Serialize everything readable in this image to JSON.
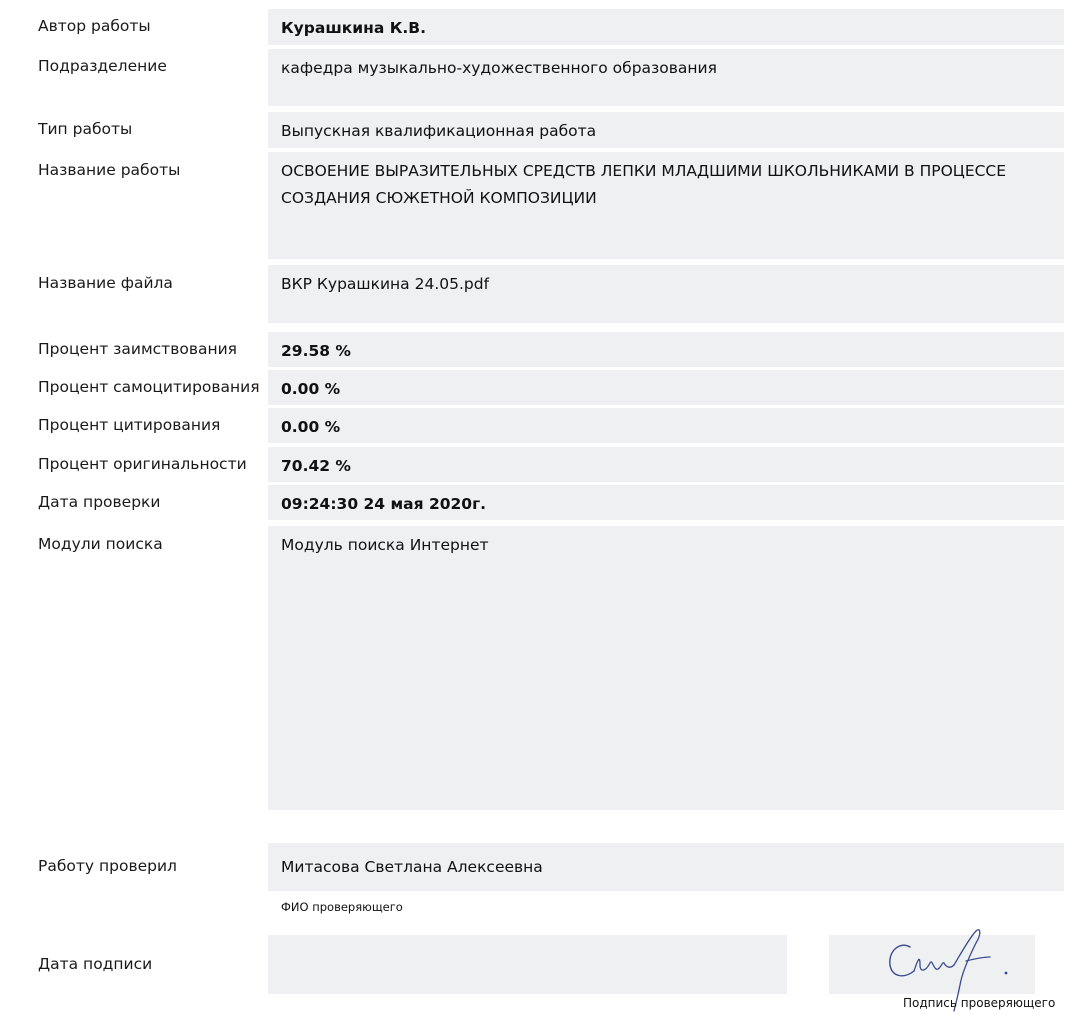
{
  "fields": {
    "author": {
      "label": "Автор работы",
      "value": "Курашкина К.В."
    },
    "department": {
      "label": "Подразделение",
      "value": "кафедра музыкально-художественного образования"
    },
    "work_type": {
      "label": "Тип работы",
      "value": "Выпускная квалификационная работа"
    },
    "work_title": {
      "label": "Название работы",
      "value": "ОСВОЕНИЕ ВЫРАЗИТЕЛЬНЫХ СРЕДСТВ ЛЕПКИ МЛАДШИМИ ШКОЛЬНИКАМИ В ПРОЦЕССЕ СОЗДАНИЯ СЮЖЕТНОЙ КОМПОЗИЦИИ"
    },
    "file_name": {
      "label": "Название файла",
      "value": "ВКР Курашкина 24.05.pdf"
    },
    "borrowing": {
      "label": "Процент заимствования",
      "value": "29.58 %"
    },
    "self_citation": {
      "label": "Процент самоцитирования",
      "value": "0.00 %"
    },
    "citation": {
      "label": "Процент цитирования",
      "value": "0.00 %"
    },
    "originality": {
      "label": "Процент оригинальности",
      "value": "70.42 %"
    },
    "check_date": {
      "label": "Дата проверки",
      "value": "09:24:30 24 мая 2020г."
    },
    "search_modules": {
      "label": "Модули поиска",
      "value": "Модуль поиска Интернет"
    },
    "checked_by": {
      "label": "Работу проверил",
      "value": "Митасова Светлана Алексеевна",
      "caption": "ФИО проверяющего"
    },
    "sign_date": {
      "label": "Дата подписи",
      "value": ""
    },
    "signature": {
      "caption": "Подпись проверяющего",
      "handwriting": "Смит"
    }
  },
  "colors": {
    "field_bg": "#eef0f2",
    "signature_ink": "#3a4a8c"
  }
}
